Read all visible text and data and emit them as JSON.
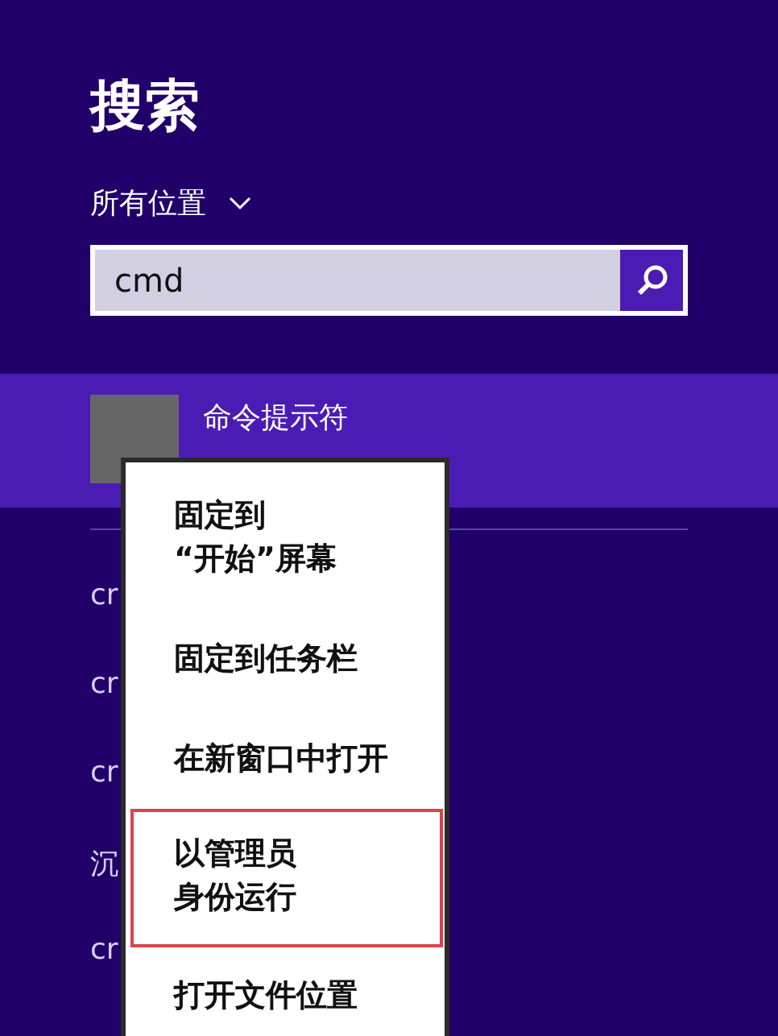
{
  "title": "搜索",
  "scope": {
    "label": "所有位置"
  },
  "search": {
    "value": "cmd"
  },
  "results": [
    {
      "label": "命令提示符",
      "selected": true
    },
    {
      "label": "cr",
      "selected": false
    },
    {
      "label": "cr",
      "selected": false
    },
    {
      "label": "cr",
      "selected": false
    },
    {
      "label": "沉",
      "selected": false
    },
    {
      "label": "cr",
      "selected": false
    }
  ],
  "context_menu": {
    "items": [
      {
        "lines": [
          "固定到",
          "“开始”屏幕"
        ],
        "selected": false
      },
      {
        "lines": [
          "固定到任务栏"
        ],
        "selected": false
      },
      {
        "lines": [
          "在新窗口中打开"
        ],
        "selected": false
      },
      {
        "lines": [
          "以管理员",
          "身份运行"
        ],
        "selected": true
      },
      {
        "lines": [
          "打开文件位置"
        ],
        "selected": false
      }
    ]
  }
}
